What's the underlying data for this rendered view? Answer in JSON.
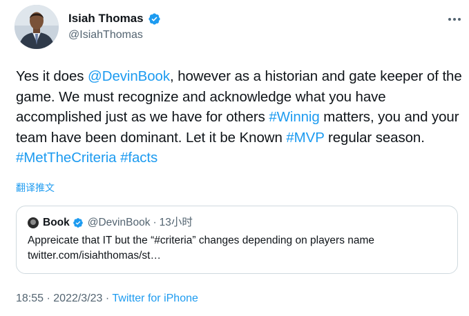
{
  "author": {
    "name": "Isiah Thomas",
    "handle": "@IsiahThomas",
    "verified": true
  },
  "tweet": {
    "segments": [
      {
        "text": "Yes it does ",
        "type": "text"
      },
      {
        "text": "@DevinBook",
        "type": "link"
      },
      {
        "text": ", however as a historian and gate keeper of the game. We must recognize and acknowledge what you have accomplished just as we have for others ",
        "type": "text"
      },
      {
        "text": "#Winnig",
        "type": "link"
      },
      {
        "text": " matters, you and your team have been dominant. Let it be Known ",
        "type": "text"
      },
      {
        "text": "#MVP",
        "type": "link"
      },
      {
        "text": " regular season. ",
        "type": "text"
      },
      {
        "text": "#MetTheCriteria",
        "type": "link"
      },
      {
        "text": " ",
        "type": "text"
      },
      {
        "text": "#facts",
        "type": "link"
      }
    ]
  },
  "translate_label": "翻译推文",
  "quote": {
    "name": "Book",
    "handle": "@DevinBook",
    "separator": "·",
    "time": "13小时",
    "text_line1": "Appreicate that IT but the “#criteria” changes depending on players name",
    "text_line2": "twitter.com/isiahthomas/st…"
  },
  "meta": {
    "time": "18:55",
    "sep1": " · ",
    "date": "2022/3/23",
    "sep2": " · ",
    "source": "Twitter for iPhone"
  },
  "colors": {
    "accent": "#1d9bf0",
    "text": "#0f1419",
    "secondary": "#536471",
    "border": "#cfd9de"
  },
  "icons": {
    "verified": "verified-badge-icon",
    "more": "more-options-icon"
  }
}
